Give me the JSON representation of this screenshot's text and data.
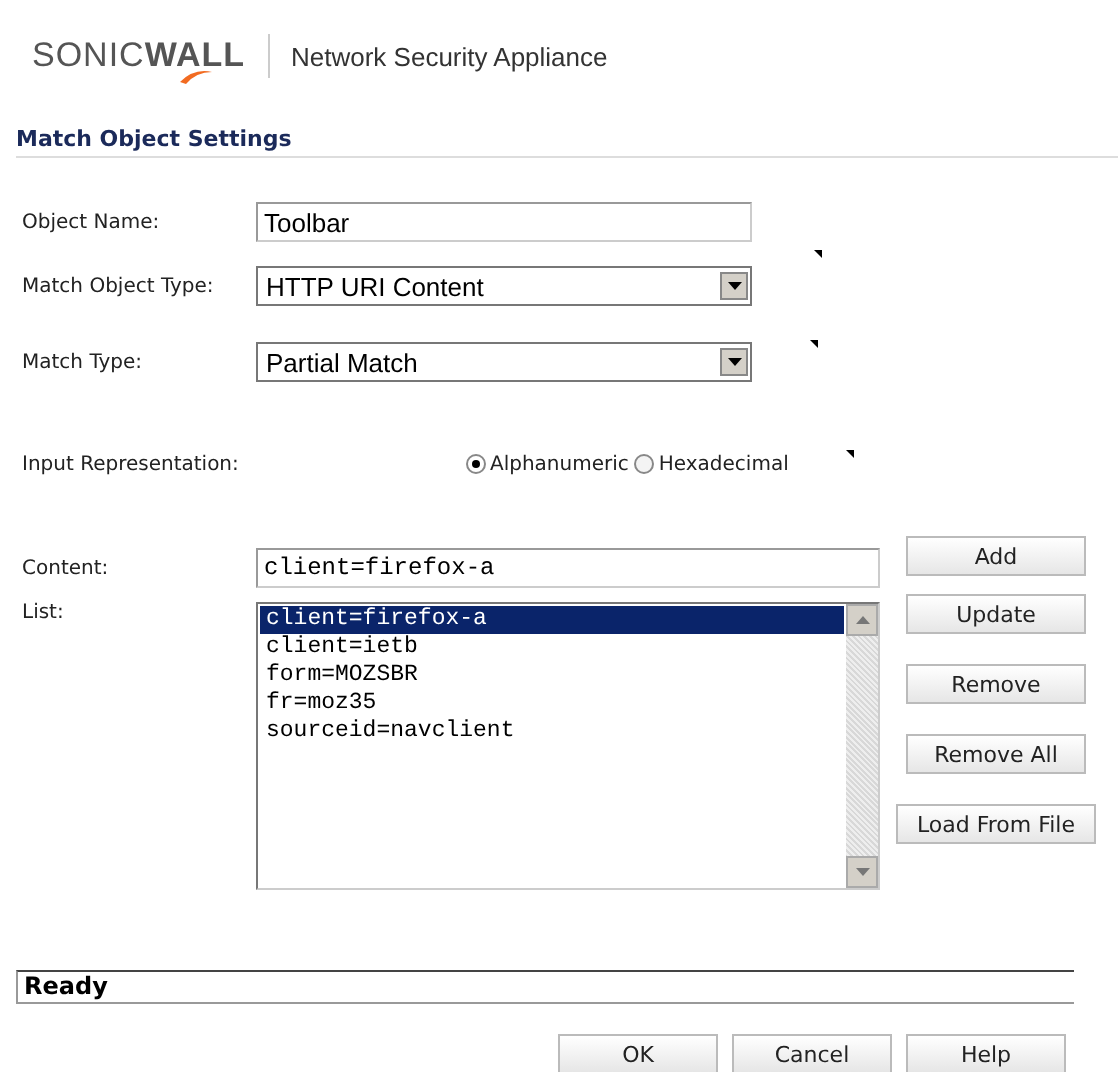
{
  "header": {
    "logo": "SONIC**WALL**",
    "product": "Network Security Appliance"
  },
  "section_title": "Match Object Settings",
  "form": {
    "object_name": {
      "label": "Object Name:",
      "value": "Toolbar"
    },
    "match_object_type": {
      "label": "Match Object Type:",
      "value": "HTTP URI Content"
    },
    "match_type": {
      "label": "Match Type:",
      "value": "Partial Match"
    },
    "input_representation": {
      "label": "Input Representation:",
      "options": [
        {
          "label": "Alphanumeric",
          "selected": true
        },
        {
          "label": "Hexadecimal",
          "selected": false
        }
      ]
    },
    "content": {
      "label": "Content:",
      "value": "client=firefox-a"
    },
    "list": {
      "label": "List:",
      "items": [
        {
          "text": "client=firefox-a",
          "selected": true
        },
        {
          "text": "client=ietb",
          "selected": false
        },
        {
          "text": "form=MOZSBR",
          "selected": false
        },
        {
          "text": "fr=moz35",
          "selected": false
        },
        {
          "text": "sourceid=navclient",
          "selected": false
        }
      ]
    }
  },
  "side_buttons": [
    "Add",
    "Update",
    "Remove",
    "Remove All",
    "Load From File"
  ],
  "status_bar": "Ready",
  "buttons": [
    "OK",
    "Cancel",
    "Help"
  ]
}
